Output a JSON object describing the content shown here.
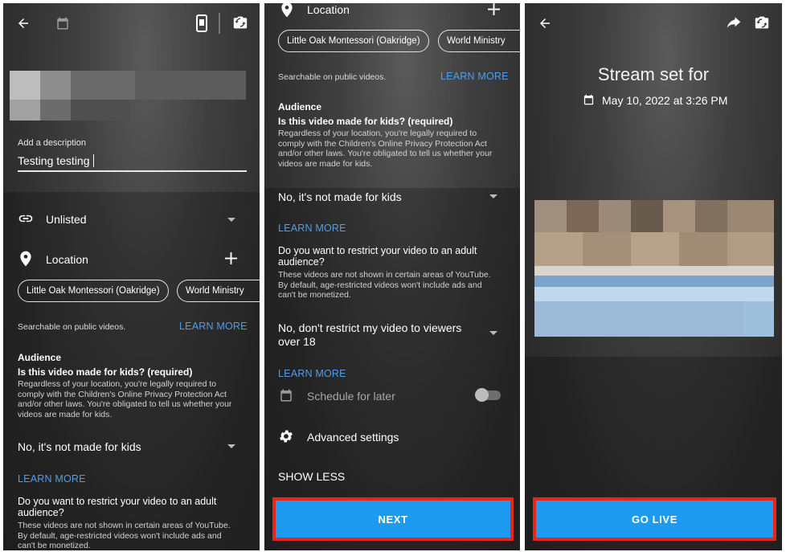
{
  "panel1": {
    "description_label": "Add a description",
    "description_value": "Testing testing",
    "visibility": "Unlisted",
    "location_label": "Location",
    "chips": [
      "Little Oak Montessori (Oakridge)",
      "World Ministry"
    ],
    "searchable_text": "Searchable on public videos.",
    "learn_more_1": "LEARN MORE",
    "audience_heading": "Audience",
    "kids_question": "Is this video made for kids? (required)",
    "kids_legal": "Regardless of your location, you're legally required to comply with the Children's Online Privacy Protection Act and/or other laws. You're obligated to tell us whether your videos are made for kids.",
    "kids_select": "No, it's not made for kids",
    "learn_more_2": "LEARN MORE",
    "restrict_question": "Do you want to restrict your video to an adult audience?",
    "restrict_info": "These videos are not shown in certain areas of YouTube. By default, age-restricted videos won't include ads and can't be monetized."
  },
  "panel2": {
    "location_label": "Location",
    "chips": [
      "Little Oak Montessori (Oakridge)",
      "World Ministry"
    ],
    "searchable_text": "Searchable on public videos.",
    "learn_more_1": "LEARN MORE",
    "audience_heading": "Audience",
    "kids_question": "Is this video made for kids? (required)",
    "kids_legal": "Regardless of your location, you're legally required to comply with the Children's Online Privacy Protection Act and/or other laws. You're obligated to tell us whether your videos are made for kids.",
    "kids_select": "No, it's not made for kids",
    "learn_more_2": "LEARN MORE",
    "restrict_question": "Do you want to restrict your video to an adult audience?",
    "restrict_info": "These videos are not shown in certain areas of YouTube. By default, age-restricted videos won't include ads and can't be monetized.",
    "restrict_select": "No, don't restrict my video to viewers over 18",
    "learn_more_3": "LEARN MORE",
    "schedule_label": "Schedule for later",
    "schedule_on": false,
    "advanced_label": "Advanced settings",
    "show_less": "SHOW LESS",
    "next_button": "NEXT"
  },
  "panel3": {
    "stream_title": "Stream set for",
    "stream_date": "May 10, 2022 at 3:26 PM",
    "go_live_button": "GO LIVE"
  },
  "colors": {
    "link": "#4f9ded",
    "button": "#1e9bf0",
    "highlight_border": "#e5261d"
  },
  "icons": [
    "back-arrow-icon",
    "calendar-icon",
    "phone-icon",
    "camera-flip-icon",
    "link-icon",
    "location-pin-icon",
    "plus-icon",
    "gear-icon",
    "share-icon"
  ]
}
